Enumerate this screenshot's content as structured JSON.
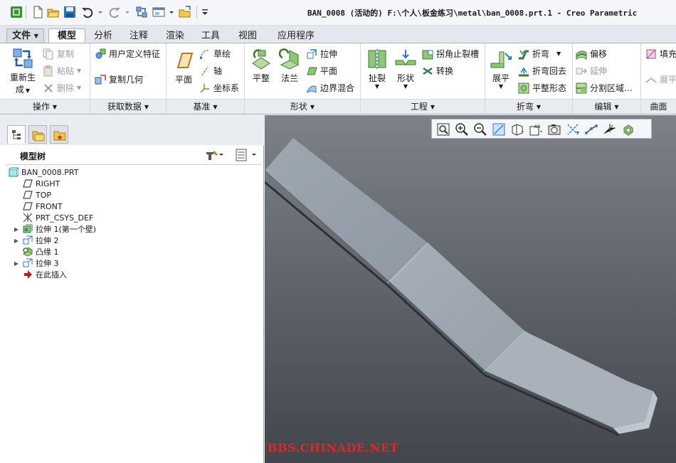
{
  "window": {
    "title": "BAN_0008 (活动的) F:\\个人\\板金练习\\metal\\ban_0008.prt.1 - Creo Parametric"
  },
  "quick_access": {
    "icons": [
      "app-logo-icon",
      "new-file-icon",
      "open-folder-icon",
      "save-icon",
      "undo-icon",
      "redo-icon",
      "regenerate-icon",
      "window-icon",
      "close-window-icon",
      "customize-icon"
    ]
  },
  "tabs": {
    "file": "文件",
    "model": "模型",
    "analysis": "分析",
    "annotate": "注释",
    "render": "渲染",
    "tools": "工具",
    "view": "视图",
    "applications": "应用程序"
  },
  "ribbon": {
    "operations": {
      "label": "操作",
      "regenerate_line1": "重新生",
      "regenerate_line2": "成",
      "copy": "复制",
      "paste": "粘贴",
      "delete": "删除"
    },
    "get_data": {
      "label": "获取数据",
      "user_defined_feature": "用户定义特征",
      "copy_geometry": "复制几何"
    },
    "datum": {
      "label": "基准",
      "plane": "平面",
      "sketch": "草绘",
      "axis": "轴",
      "coordinate_system": "坐标系"
    },
    "shapes": {
      "label": "形状",
      "flat": "平整",
      "flange": "法兰",
      "extrude": "拉伸",
      "planar": "平面",
      "boundary_blend": "边界混合"
    },
    "engineering": {
      "label": "工程",
      "rip": "扯裂",
      "form": "形状",
      "corner_relief": "拐角止裂槽",
      "convert": "转换"
    },
    "bends": {
      "label": "折弯",
      "unbend": "展平",
      "bend": "折弯",
      "bend_back": "折弯回去",
      "flatten_form": "平整形态"
    },
    "editing": {
      "label": "编辑",
      "offset": "偏移",
      "extend": "延伸",
      "split_area": "分割区域…"
    },
    "surfaces": {
      "label": "曲面",
      "fill": "填充",
      "unfold": "展平"
    }
  },
  "model_tree": {
    "title": "模型树",
    "items": [
      {
        "label": "BAN_0008.PRT",
        "icon": "part-icon",
        "expandable": false
      },
      {
        "label": "RIGHT",
        "icon": "datum-plane-icon",
        "expandable": false
      },
      {
        "label": "TOP",
        "icon": "datum-plane-icon",
        "expandable": false
      },
      {
        "label": "FRONT",
        "icon": "datum-plane-icon",
        "expandable": false
      },
      {
        "label": "PRT_CSYS_DEF",
        "icon": "coordinate-system-icon",
        "expandable": false
      },
      {
        "label": "拉伸 1(第一个壁)",
        "icon": "first-wall-icon",
        "expandable": true
      },
      {
        "label": "拉伸 2",
        "icon": "extrude-icon",
        "expandable": true
      },
      {
        "label": "凸缘 1",
        "icon": "flange-icon",
        "expandable": false
      },
      {
        "label": "拉伸 3",
        "icon": "extrude-icon",
        "expandable": true
      },
      {
        "label": "在此插入",
        "icon": "insert-here-arrow-icon",
        "expandable": false
      }
    ]
  },
  "viewport": {
    "watermark": "BBS.CHINADE.NET",
    "toolbar_icons": [
      "refit-icon",
      "zoom-in-icon",
      "zoom-out-icon",
      "repaint-icon",
      "display-style-icon",
      "saved-views-icon",
      "view-manager-icon",
      "datum-planes-display-icon",
      "datum-axes-display-icon",
      "points-display-icon",
      "csys-display-icon",
      "spin-center-icon"
    ]
  },
  "colors": {
    "accent_tab": "#ffffff",
    "ribbon_group_bg": "#e8ebf0",
    "viewport_top": "#7d8188",
    "viewport_bottom": "#43464c",
    "part_surface": "#a3acb5",
    "watermark": "#d82a2a"
  }
}
